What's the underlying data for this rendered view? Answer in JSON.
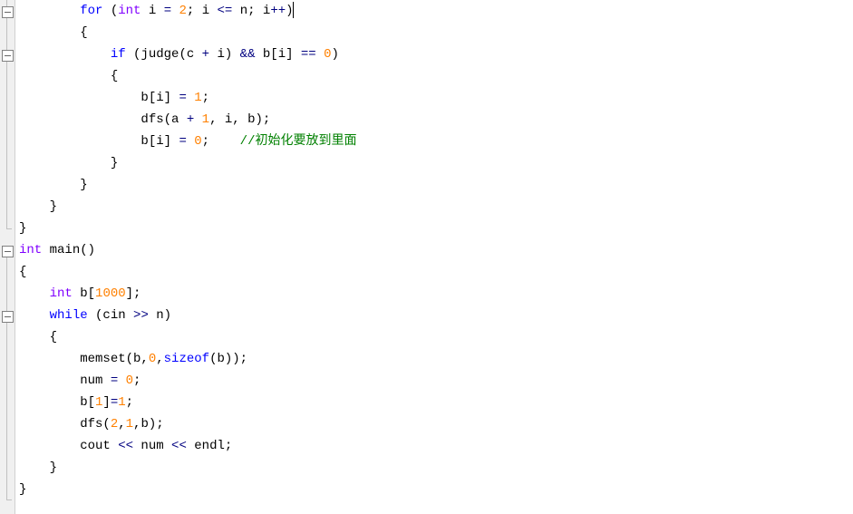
{
  "fold_markers": [
    {
      "line": 0,
      "type": "minus"
    },
    {
      "line": 3,
      "type": "minus"
    },
    {
      "line": 11,
      "type": "minus"
    },
    {
      "line": 14,
      "type": "minus"
    }
  ],
  "lines": [
    {
      "indent": 2,
      "tokens": [
        {
          "t": "for",
          "c": "kw"
        },
        {
          "t": " (",
          "c": ""
        },
        {
          "t": "int",
          "c": "type"
        },
        {
          "t": " i ",
          "c": ""
        },
        {
          "t": "=",
          "c": "op"
        },
        {
          "t": " ",
          "c": ""
        },
        {
          "t": "2",
          "c": "num"
        },
        {
          "t": "; i ",
          "c": ""
        },
        {
          "t": "<=",
          "c": "op"
        },
        {
          "t": " n; i",
          "c": ""
        },
        {
          "t": "++",
          "c": "op"
        },
        {
          "t": ")",
          "c": ""
        }
      ],
      "has_cursor": true
    },
    {
      "indent": 2,
      "raw": "{"
    },
    {
      "indent": 3,
      "tokens": [
        {
          "t": "if",
          "c": "kw"
        },
        {
          "t": " (judge(c ",
          "c": ""
        },
        {
          "t": "+",
          "c": "op"
        },
        {
          "t": " i) ",
          "c": ""
        },
        {
          "t": "&&",
          "c": "op"
        },
        {
          "t": " b[i] ",
          "c": ""
        },
        {
          "t": "==",
          "c": "op"
        },
        {
          "t": " ",
          "c": ""
        },
        {
          "t": "0",
          "c": "num"
        },
        {
          "t": ")",
          "c": ""
        }
      ]
    },
    {
      "indent": 3,
      "raw": "{"
    },
    {
      "indent": 4,
      "tokens": [
        {
          "t": "b[i] ",
          "c": ""
        },
        {
          "t": "=",
          "c": "op"
        },
        {
          "t": " ",
          "c": ""
        },
        {
          "t": "1",
          "c": "num"
        },
        {
          "t": ";",
          "c": ""
        }
      ]
    },
    {
      "indent": 4,
      "tokens": [
        {
          "t": "dfs(a ",
          "c": ""
        },
        {
          "t": "+",
          "c": "op"
        },
        {
          "t": " ",
          "c": ""
        },
        {
          "t": "1",
          "c": "num"
        },
        {
          "t": ", i, b);",
          "c": ""
        }
      ]
    },
    {
      "indent": 4,
      "tokens": [
        {
          "t": "b[i] ",
          "c": ""
        },
        {
          "t": "=",
          "c": "op"
        },
        {
          "t": " ",
          "c": ""
        },
        {
          "t": "0",
          "c": "num"
        },
        {
          "t": ";    ",
          "c": ""
        },
        {
          "t": "//初始化要放到里面",
          "c": "comment"
        }
      ]
    },
    {
      "indent": 3,
      "raw": "}"
    },
    {
      "indent": 2,
      "raw": "}"
    },
    {
      "indent": 1,
      "raw": "}"
    },
    {
      "indent": 0,
      "raw": "}"
    },
    {
      "indent": 0,
      "tokens": [
        {
          "t": "int",
          "c": "type"
        },
        {
          "t": " main()",
          "c": ""
        }
      ]
    },
    {
      "indent": 0,
      "raw": "{"
    },
    {
      "indent": 1,
      "tokens": [
        {
          "t": "int",
          "c": "type"
        },
        {
          "t": " b[",
          "c": ""
        },
        {
          "t": "1000",
          "c": "num"
        },
        {
          "t": "];",
          "c": ""
        }
      ]
    },
    {
      "indent": 1,
      "tokens": [
        {
          "t": "while",
          "c": "kw"
        },
        {
          "t": " (cin ",
          "c": ""
        },
        {
          "t": ">>",
          "c": "op"
        },
        {
          "t": " n)",
          "c": ""
        }
      ]
    },
    {
      "indent": 1,
      "raw": "{"
    },
    {
      "indent": 2,
      "tokens": [
        {
          "t": "memset(b,",
          "c": ""
        },
        {
          "t": "0",
          "c": "num"
        },
        {
          "t": ",",
          "c": ""
        },
        {
          "t": "sizeof",
          "c": "kw"
        },
        {
          "t": "(b));",
          "c": ""
        }
      ]
    },
    {
      "indent": 2,
      "tokens": [
        {
          "t": "num ",
          "c": ""
        },
        {
          "t": "=",
          "c": "op"
        },
        {
          "t": " ",
          "c": ""
        },
        {
          "t": "0",
          "c": "num"
        },
        {
          "t": ";",
          "c": ""
        }
      ]
    },
    {
      "indent": 2,
      "tokens": [
        {
          "t": "b[",
          "c": ""
        },
        {
          "t": "1",
          "c": "num"
        },
        {
          "t": "]",
          "c": ""
        },
        {
          "t": "=",
          "c": "op"
        },
        {
          "t": "1",
          "c": "num"
        },
        {
          "t": ";",
          "c": ""
        }
      ]
    },
    {
      "indent": 2,
      "tokens": [
        {
          "t": "dfs(",
          "c": ""
        },
        {
          "t": "2",
          "c": "num"
        },
        {
          "t": ",",
          "c": ""
        },
        {
          "t": "1",
          "c": "num"
        },
        {
          "t": ",b);",
          "c": ""
        }
      ]
    },
    {
      "indent": 2,
      "tokens": [
        {
          "t": "cout ",
          "c": ""
        },
        {
          "t": "<<",
          "c": "op"
        },
        {
          "t": " num ",
          "c": ""
        },
        {
          "t": "<<",
          "c": "op"
        },
        {
          "t": " endl;",
          "c": ""
        }
      ]
    },
    {
      "indent": 1,
      "raw": "}"
    },
    {
      "indent": 0,
      "raw": "}"
    }
  ],
  "indent_unit": "    "
}
